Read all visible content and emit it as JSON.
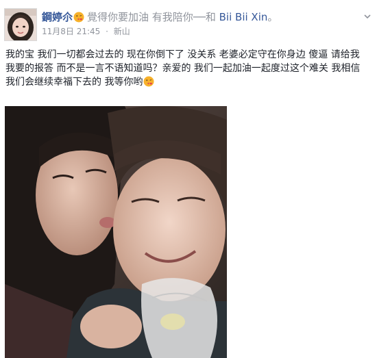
{
  "post": {
    "author": "鋼婷尒",
    "feeling_text": "覺得你要加油 有我陪你──和",
    "tagged_name": "Bii Bii Xin",
    "trailing_punct": "。",
    "timestamp": "11月8日 21:45",
    "separator": "·",
    "location": "新山",
    "body_text": "我的宝 我们一切都会过去的 现在你倒下了 没关系 老婆必定守在你身边 傻逼 请给我我要的报答 而不是一言不语知道吗？亲爱的 我们一起加油一起度过这个难关 我相信我们会继续幸福下去的 我等你哟",
    "emoji_icon": "kissing-face-emoji",
    "menu_icon": "chevron-down-icon",
    "photo_alt_icon": "couple-photo"
  },
  "colors": {
    "link": "#365899",
    "meta": "#90949c",
    "text": "#1d2129"
  }
}
